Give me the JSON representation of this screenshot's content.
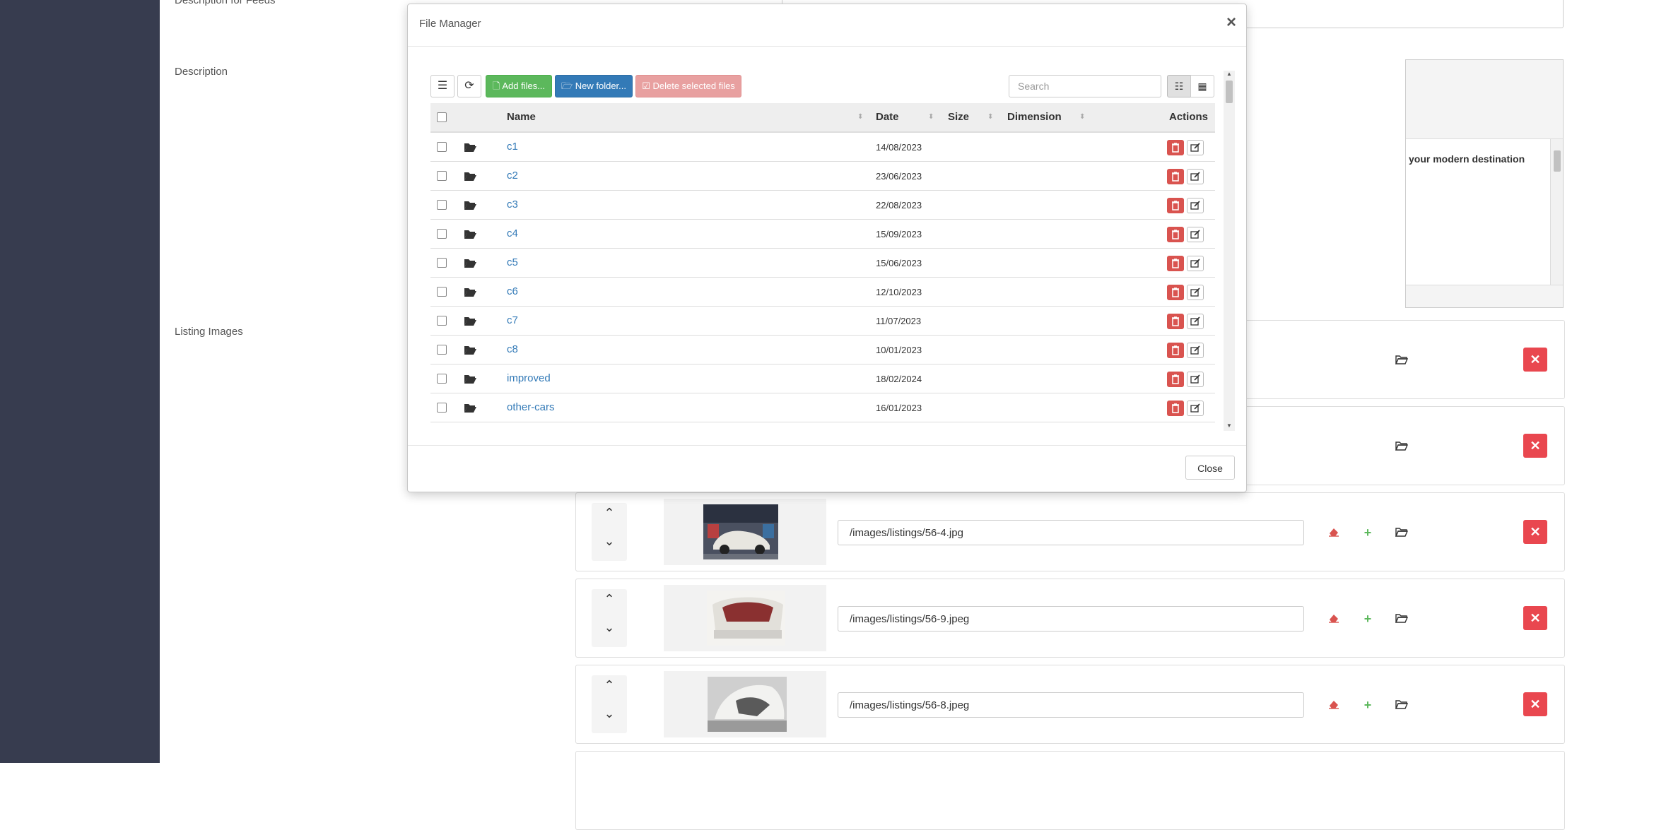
{
  "page": {
    "labels": {
      "feeds": "Description for Feeds",
      "description": "Description",
      "listing_images": "Listing Images"
    },
    "editor_snippet": "your modern destination",
    "image_rows": [
      {
        "path": "/images/listings/56-4.jpg"
      },
      {
        "path": "/images/listings/56-9.jpeg"
      },
      {
        "path": "/images/listings/56-8.jpeg"
      }
    ],
    "icons": {
      "up": "chevron-up-icon",
      "down": "chevron-down-icon",
      "eraser": "eraser-icon",
      "plus": "plus-icon",
      "folder": "folder-open-icon",
      "remove": "close-icon"
    }
  },
  "modal": {
    "title": "File Manager",
    "close_glyph": "×",
    "footer_close": "Close",
    "toolbar": {
      "add_files": "Add files...",
      "new_folder": "New folder...",
      "delete_selected": "Delete selected files",
      "search_placeholder": "Search"
    },
    "columns": {
      "name": "Name",
      "date": "Date",
      "size": "Size",
      "dimension": "Dimension",
      "actions": "Actions"
    },
    "rows": [
      {
        "name": "c1",
        "date": "14/08/2023"
      },
      {
        "name": "c2",
        "date": "23/06/2023"
      },
      {
        "name": "c3",
        "date": "22/08/2023"
      },
      {
        "name": "c4",
        "date": "15/09/2023"
      },
      {
        "name": "c5",
        "date": "15/06/2023"
      },
      {
        "name": "c6",
        "date": "12/10/2023"
      },
      {
        "name": "c7",
        "date": "11/07/2023"
      },
      {
        "name": "c8",
        "date": "10/01/2023"
      },
      {
        "name": "improved",
        "date": "18/02/2024"
      },
      {
        "name": "other-cars",
        "date": "16/01/2023"
      }
    ]
  },
  "colors": {
    "sidebar": "#373c4f",
    "success": "#5cb85c",
    "primary": "#337ab7",
    "danger": "#d9534f",
    "danger_light": "#e8a0a0",
    "remove": "#e9474f"
  }
}
